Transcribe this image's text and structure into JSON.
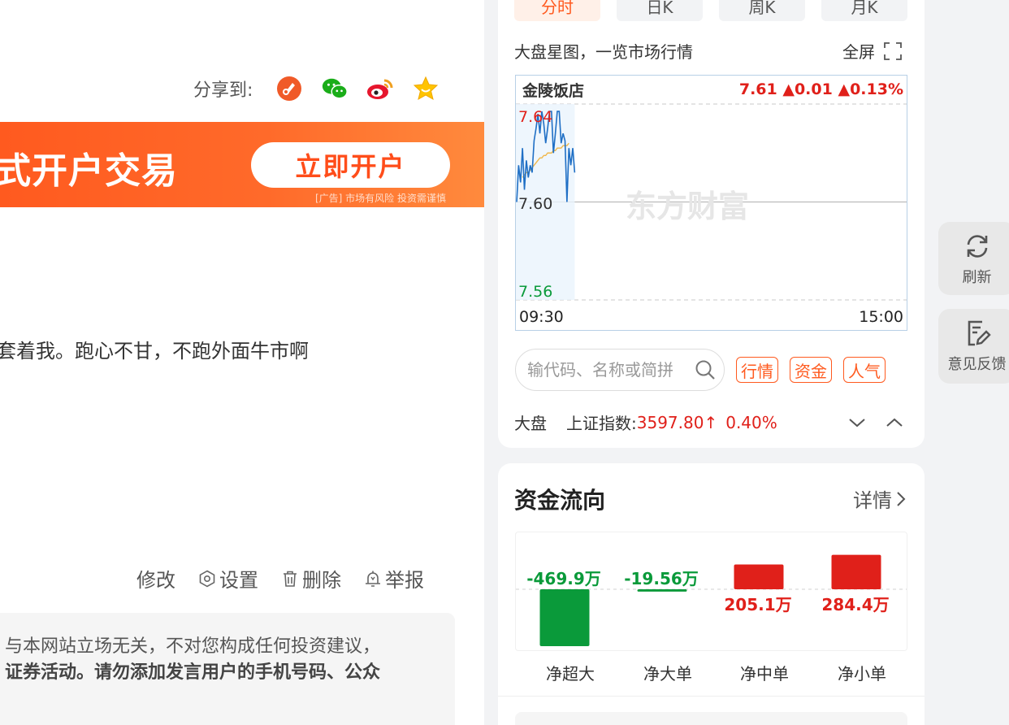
{
  "post": {
    "share_label": "分享到:",
    "share_targets": [
      "share-app-icon",
      "wechat-icon",
      "weibo-icon",
      "favorite-star-icon"
    ],
    "banner_text": "式开户交易",
    "banner_button": "立即开户",
    "banner_ad": "[广告] 市场有风险 投资需谨慎",
    "body_text": "套着我。跑心不甘，不跑外面牛市啊",
    "actions": {
      "edit": "修改",
      "settings": "设置",
      "delete": "删除",
      "report": "举报"
    },
    "disclaimer_line1": "与本网站立场无关，不对您构成任何投资建议，",
    "disclaimer_line2": "证券活动。请勿添加发言用户的手机号码、公众"
  },
  "market": {
    "tabs": [
      "分时",
      "日K",
      "周K",
      "月K"
    ],
    "active_tab": 0,
    "intro": "大盘星图，一览市场行情",
    "fullscreen_label": "全屏",
    "stock_name": "金陵饭店",
    "quote": "7.61 ▲0.01 ▲0.13%",
    "watermark": "东方财富",
    "y_labels": {
      "high": "7.64",
      "mid": "7.60",
      "low": "7.56"
    },
    "x_labels": {
      "start": "09:30",
      "end": "15:00"
    },
    "search_placeholder": "输代码、名称或简拼",
    "tag_buttons": [
      "行情",
      "资金",
      "人气"
    ],
    "index_prefix": "大盘",
    "index_name": "上证指数:",
    "index_value": "3597.80↑",
    "index_change": "0.40%",
    "colors": {
      "accent": "#ff5a1f",
      "up": "#e0201a",
      "down": "#0a9a3a",
      "line": "#1f6fc5",
      "avg": "#f0b84b"
    }
  },
  "chart_data": {
    "type": "line",
    "title": "金陵饭店",
    "xlabel": "",
    "ylabel": "",
    "ylim": [
      7.56,
      7.64
    ],
    "x_ticks": [
      "09:30",
      "15:00"
    ],
    "y_ticks": [
      7.56,
      7.6,
      7.64
    ],
    "reference": 7.6,
    "series": [
      {
        "name": "",
        "values": [
          7.6,
          7.615,
          7.608,
          7.622,
          7.605,
          7.617,
          7.61,
          7.615,
          7.612,
          7.625,
          7.63,
          7.636,
          7.628,
          7.637,
          7.632,
          7.624,
          7.63,
          7.637,
          7.637,
          7.62,
          7.628,
          7.637,
          7.637,
          7.624,
          7.628,
          7.625,
          7.6,
          7.622,
          7.615,
          7.622,
          7.612
        ]
      },
      {
        "name": "",
        "values": [
          7.61,
          7.611,
          7.612,
          7.612,
          7.613,
          7.614,
          7.615,
          7.616,
          7.617,
          7.618,
          7.618,
          7.619,
          7.619,
          7.62,
          7.62,
          7.62,
          7.621,
          7.621,
          7.622,
          7.622,
          7.622,
          7.623,
          7.623,
          7.623,
          7.624
        ]
      }
    ]
  },
  "fund_flow": {
    "title": "资金流向",
    "more_label": "详情",
    "chart_data": {
      "type": "bar",
      "categories": [
        "净超大",
        "净大单",
        "净中单",
        "净小单"
      ],
      "values": [
        -469.9,
        -19.56,
        205.1,
        284.4
      ],
      "labels": [
        "-469.9万",
        "-19.56万",
        "205.1万",
        "284.4万"
      ],
      "unit": "万"
    }
  },
  "sidebar": {
    "refresh_label": "刷新",
    "feedback_label": "意见反馈"
  }
}
